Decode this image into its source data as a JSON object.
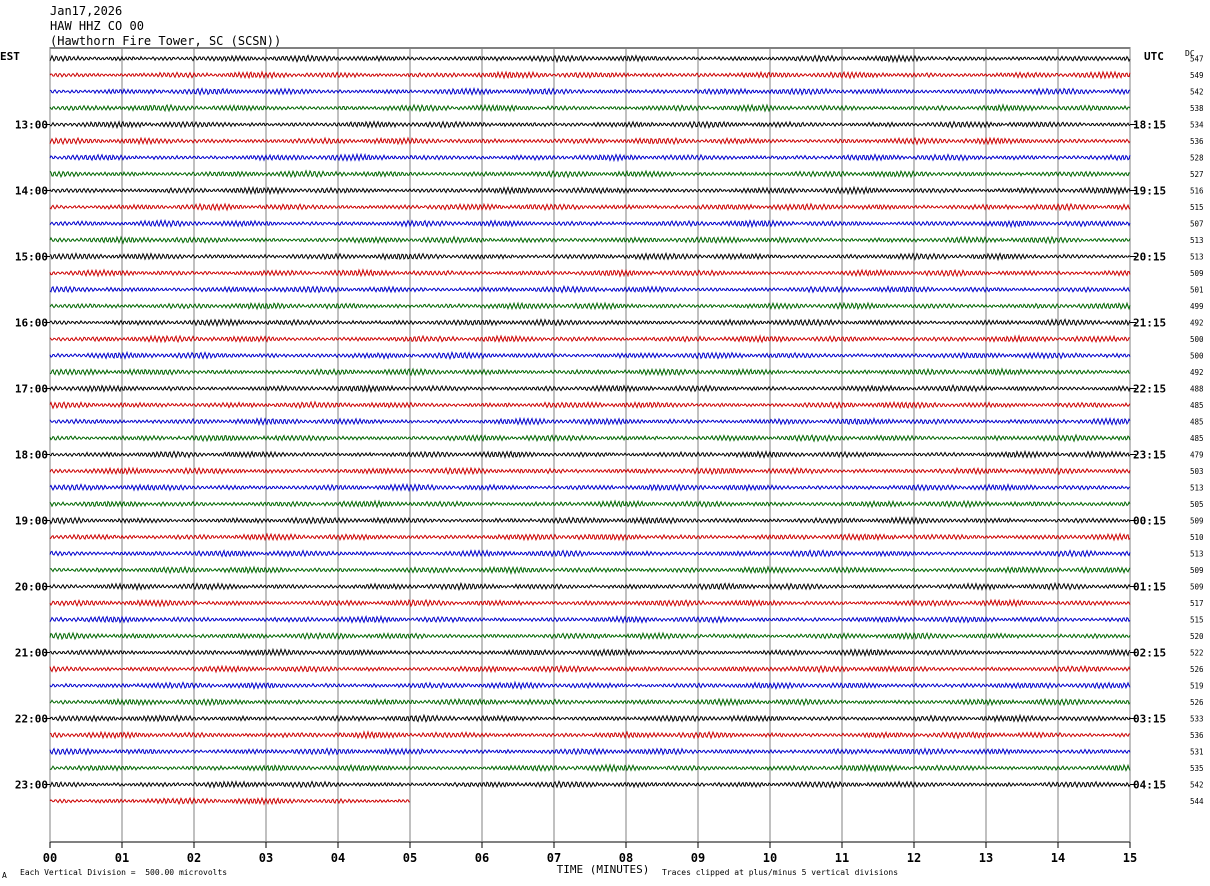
{
  "header": {
    "date": "Jan17,2026",
    "station": "HAW HHZ CO 00",
    "location": "(Hawthorn Fire Tower, SC (SCSN))"
  },
  "left_timezone": "EST",
  "right_timezone": "UTC",
  "dc_header": "DC",
  "footer": {
    "scale_note": "Each Vertical Division =  500.00 microvolts",
    "clip_note": "Traces clipped at plus/minus 5 vertical divisions",
    "corner_mark": "A"
  },
  "colors": {
    "black": "#000000",
    "red": "#cc0000",
    "blue": "#0000cc",
    "green": "#006600",
    "grid": "#808080"
  },
  "chart_data": {
    "type": "line",
    "xlabel": "TIME (MINUTES)",
    "x_ticks": [
      "00",
      "01",
      "02",
      "03",
      "04",
      "05",
      "06",
      "07",
      "08",
      "09",
      "10",
      "11",
      "12",
      "13",
      "14",
      "15"
    ],
    "xlim": [
      0,
      15
    ],
    "trace_minutes": 15,
    "trace_colors": [
      "black",
      "red",
      "blue",
      "green"
    ],
    "hour_labels_left": [
      "13:00",
      "14:00",
      "15:00",
      "16:00",
      "17:00",
      "18:00",
      "19:00",
      "20:00",
      "21:00",
      "22:00",
      "23:00"
    ],
    "hour_labels_right": [
      "18:15",
      "19:15",
      "20:15",
      "21:15",
      "22:15",
      "23:15",
      "00:15",
      "01:15",
      "02:15",
      "03:15",
      "04:15"
    ],
    "dc_offsets": [
      547,
      549,
      542,
      538,
      534,
      536,
      528,
      527,
      516,
      515,
      507,
      513,
      513,
      509,
      501,
      499,
      492,
      500,
      500,
      492,
      488,
      485,
      485,
      485,
      479,
      503,
      513,
      505,
      509,
      510,
      513,
      509,
      509,
      517,
      515,
      520,
      522,
      526,
      519,
      526,
      533,
      536,
      531,
      535,
      542,
      544
    ],
    "last_trace_minutes": 5
  }
}
